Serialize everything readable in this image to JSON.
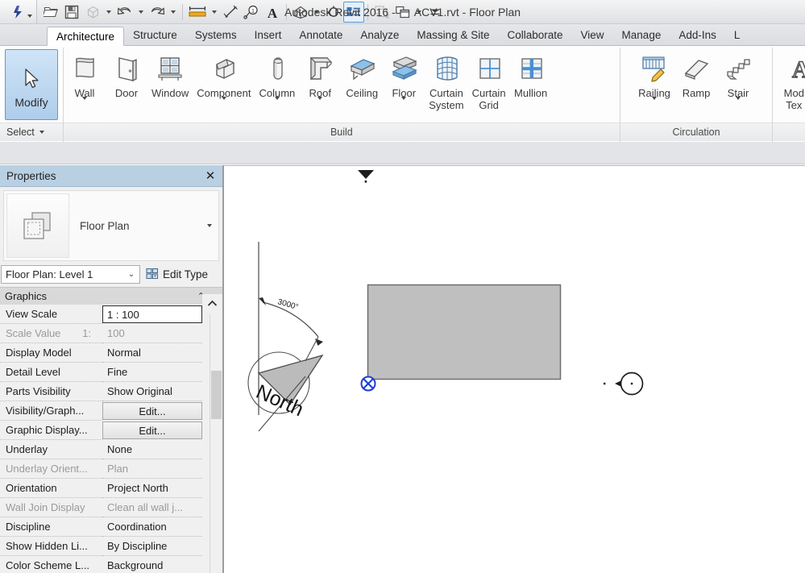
{
  "window": {
    "app_title": "Autodesk Revit 2016 -",
    "document_title": "ACV1.rvt - Floor Plan"
  },
  "quick_access": {
    "app_menu_icon": "revit-app-logo-icon",
    "items": [
      {
        "name": "open-icon",
        "label": "Open"
      },
      {
        "name": "save-icon",
        "label": "Save"
      },
      {
        "name": "sync-with-central-icon",
        "label": "Synchronize with Central",
        "has_dropdown": true,
        "disabled": true
      },
      {
        "name": "undo-icon",
        "label": "Undo",
        "has_dropdown": true
      },
      {
        "name": "redo-icon",
        "label": "Redo",
        "has_dropdown": true
      },
      {
        "name": "measure-icon",
        "label": "Measure",
        "has_dropdown": true
      },
      {
        "name": "aligned-dimension-icon",
        "label": "Aligned Dimension"
      },
      {
        "name": "tag-by-category-icon",
        "label": "Tag by Category"
      },
      {
        "name": "text-icon",
        "label": "Text"
      },
      {
        "name": "default-3d-view-icon",
        "label": "Default 3D View",
        "has_dropdown": true
      },
      {
        "name": "section-icon",
        "label": "Section"
      },
      {
        "name": "thin-lines-icon",
        "label": "Thin Lines",
        "active": true
      },
      {
        "name": "close-hidden-windows-icon",
        "label": "Close Hidden Windows",
        "disabled": true
      },
      {
        "name": "switch-windows-icon",
        "label": "Switch Windows",
        "has_dropdown": true
      },
      {
        "name": "customize-qat-icon",
        "label": "Customize Quick Access Toolbar"
      }
    ]
  },
  "ribbon": {
    "tabs": [
      {
        "label": "Architecture",
        "selected": true
      },
      {
        "label": "Structure",
        "selected": false
      },
      {
        "label": "Systems",
        "selected": false
      },
      {
        "label": "Insert",
        "selected": false
      },
      {
        "label": "Annotate",
        "selected": false
      },
      {
        "label": "Analyze",
        "selected": false
      },
      {
        "label": "Massing & Site",
        "selected": false
      },
      {
        "label": "Collaborate",
        "selected": false
      },
      {
        "label": "View",
        "selected": false
      },
      {
        "label": "Manage",
        "selected": false
      },
      {
        "label": "Add-Ins",
        "selected": false
      },
      {
        "label": "L",
        "selected": false
      }
    ],
    "select_panel": {
      "modify_label": "Modify",
      "panel_title": "Select"
    },
    "build_panel": {
      "title": "Build",
      "buttons": [
        {
          "label": "Wall",
          "label2": "",
          "icon": "wall-icon",
          "dropdown": true
        },
        {
          "label": "Door",
          "label2": "",
          "icon": "door-icon",
          "dropdown": false
        },
        {
          "label": "Window",
          "label2": "",
          "icon": "window-icon",
          "dropdown": false
        },
        {
          "label": "Component",
          "label2": "",
          "icon": "component-icon",
          "dropdown": true
        },
        {
          "label": "Column",
          "label2": "",
          "icon": "column-icon",
          "dropdown": true
        },
        {
          "label": "Roof",
          "label2": "",
          "icon": "roof-icon",
          "dropdown": true
        },
        {
          "label": "Ceiling",
          "label2": "",
          "icon": "ceiling-icon",
          "dropdown": false
        },
        {
          "label": "Floor",
          "label2": "",
          "icon": "floor-icon",
          "dropdown": true
        },
        {
          "label": "Curtain",
          "label2": "System",
          "icon": "curtain-system-icon",
          "dropdown": false
        },
        {
          "label": "Curtain",
          "label2": "Grid",
          "icon": "curtain-grid-icon",
          "dropdown": false
        },
        {
          "label": "Mullion",
          "label2": "",
          "icon": "mullion-icon",
          "dropdown": false
        }
      ]
    },
    "circulation_panel": {
      "title": "Circulation",
      "buttons": [
        {
          "label": "Railing",
          "label2": "",
          "icon": "railing-icon",
          "dropdown": true
        },
        {
          "label": "Ramp",
          "label2": "",
          "icon": "ramp-icon",
          "dropdown": false
        },
        {
          "label": "Stair",
          "label2": "",
          "icon": "stair-icon",
          "dropdown": true
        }
      ]
    },
    "model_panel": {
      "title": "",
      "buttons": [
        {
          "label": "Mod",
          "label2": "Tex",
          "icon": "model-text-icon",
          "dropdown": false
        }
      ]
    }
  },
  "properties": {
    "title": "Properties",
    "close_label": "✕",
    "type_thumbnail_icon": "floor-plan-thumbnail-icon",
    "family_name": "Floor Plan",
    "type_selector_value": "Floor Plan: Level 1",
    "edit_type_label": "Edit Type",
    "edit_type_icon": "edit-type-icon",
    "group": {
      "name": "Graphics",
      "collapse_icon": "double-chevron-up-icon",
      "scroll_up_icon": "chevron-up-icon"
    },
    "rows": [
      {
        "name": "View Scale",
        "value": "1 : 100",
        "name_dim": false,
        "value_dim": false,
        "style": "focused"
      },
      {
        "name": "Scale Value",
        "suffix": "1:",
        "value": "100",
        "name_dim": true,
        "value_dim": true,
        "style": "plain"
      },
      {
        "name": "Display Model",
        "value": "Normal",
        "name_dim": false,
        "value_dim": false,
        "style": "plain"
      },
      {
        "name": "Detail Level",
        "value": "Fine",
        "name_dim": false,
        "value_dim": false,
        "style": "plain"
      },
      {
        "name": "Parts Visibility",
        "value": "Show Original",
        "name_dim": false,
        "value_dim": false,
        "style": "plain"
      },
      {
        "name": "Visibility/Graph...",
        "value": "Edit...",
        "name_dim": false,
        "value_dim": false,
        "style": "button"
      },
      {
        "name": "Graphic Display...",
        "value": "Edit...",
        "name_dim": false,
        "value_dim": false,
        "style": "button"
      },
      {
        "name": "Underlay",
        "value": "None",
        "name_dim": false,
        "value_dim": false,
        "style": "plain"
      },
      {
        "name": "Underlay Orient...",
        "value": "Plan",
        "name_dim": true,
        "value_dim": true,
        "style": "plain"
      },
      {
        "name": "Orientation",
        "value": "Project North",
        "name_dim": false,
        "value_dim": false,
        "style": "plain"
      },
      {
        "name": "Wall Join Display",
        "value": "Clean all wall j...",
        "name_dim": true,
        "value_dim": true,
        "style": "plain"
      },
      {
        "name": "Discipline",
        "value": "Coordination",
        "name_dim": false,
        "value_dim": false,
        "style": "plain"
      },
      {
        "name": "Show Hidden Li...",
        "value": "By Discipline",
        "name_dim": false,
        "value_dim": false,
        "style": "plain"
      },
      {
        "name": "Color Scheme L...",
        "value": "Background",
        "name_dim": false,
        "value_dim": false,
        "style": "plain"
      }
    ]
  },
  "canvas": {
    "north_arrow_label": "North",
    "angle_dimension": "3000°",
    "slab": {
      "fill_color": "#bfbfbf",
      "border_color": "#6e6e6e"
    },
    "base_point_color": "#1a3fd4",
    "markers": [
      {
        "name": "elevation-marker-top",
        "kind": "elevation"
      },
      {
        "name": "elevation-marker-right",
        "kind": "elevation"
      },
      {
        "name": "project-base-point",
        "kind": "base-point"
      }
    ]
  },
  "colors": {
    "title_bar_bg": "#e9eaec",
    "tab_strip_bg": "#e1e2e5",
    "properties_header_bg": "#b9d0e3",
    "ribbon_bg": "#fdfdfd",
    "accent_blue": "#5b9bd5",
    "canvas_bg": "#ffffff"
  }
}
